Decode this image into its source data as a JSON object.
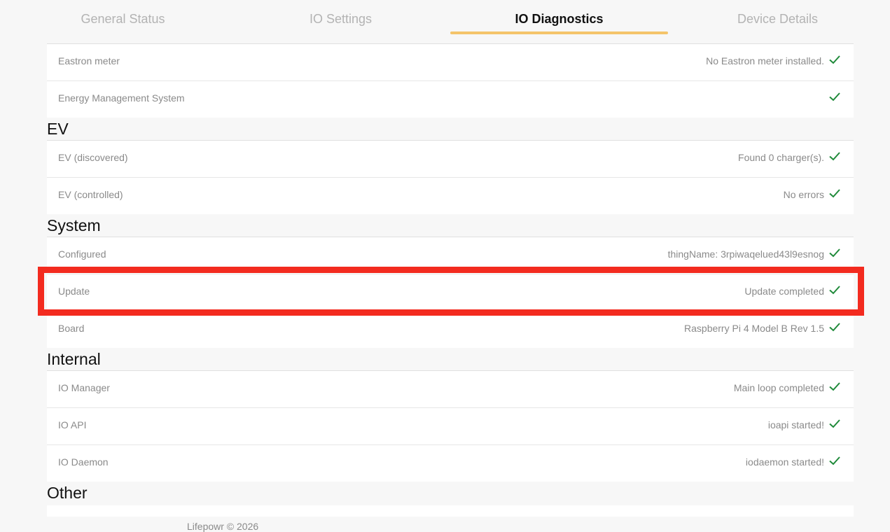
{
  "tabs": [
    {
      "label": "General Status"
    },
    {
      "label": "IO Settings"
    },
    {
      "label": "IO Diagnostics",
      "active": true
    },
    {
      "label": "Device Details"
    }
  ],
  "sections": {
    "top": {
      "rows": [
        {
          "label": "Eastron meter",
          "status": "No Eastron meter installed."
        },
        {
          "label": "Energy Management System",
          "status": ""
        }
      ]
    },
    "ev": {
      "title": "EV",
      "rows": [
        {
          "label": "EV (discovered)",
          "status": "Found 0 charger(s)."
        },
        {
          "label": "EV (controlled)",
          "status": "No errors"
        }
      ]
    },
    "system": {
      "title": "System",
      "rows": [
        {
          "label": "Configured",
          "status": "thingName: 3rpiwaqelued43l9esnog"
        },
        {
          "label": "Update",
          "status": "Update completed"
        },
        {
          "label": "Board",
          "status": "Raspberry Pi 4 Model B Rev 1.5"
        }
      ]
    },
    "internal": {
      "title": "Internal",
      "rows": [
        {
          "label": "IO Manager",
          "status": "Main loop completed"
        },
        {
          "label": "IO API",
          "status": "ioapi started!"
        },
        {
          "label": "IO Daemon",
          "status": "iodaemon started!"
        }
      ]
    },
    "other": {
      "title": "Other"
    }
  },
  "footer": {
    "text": "Lifepowr © 2026"
  },
  "colors": {
    "check": "#1f8a3a",
    "tab_underline": "#f4c46a",
    "highlight": "#f32b1f"
  },
  "icons": {
    "status_ok": "check-icon"
  }
}
